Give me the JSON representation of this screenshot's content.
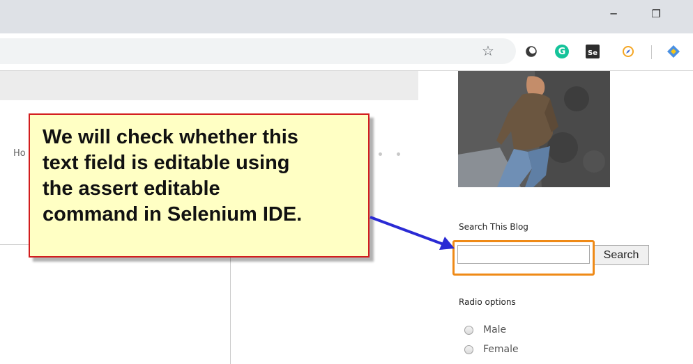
{
  "browser": {
    "window_controls": {
      "minimize_glyph": "─",
      "restore_glyph": "❐"
    },
    "toolbar": {
      "bookmark_icon": "☆",
      "extensions": [
        {
          "name": "circle-extension-icon",
          "color": "#444444"
        },
        {
          "name": "grammarly-icon",
          "letter": "G",
          "color": "#15c39a"
        },
        {
          "name": "selenium-ide-icon",
          "letter": "Se",
          "color": "#43b02a"
        },
        {
          "name": "compass-extension-icon",
          "color": "#f5a623"
        },
        {
          "name": "diamond-extension-icon",
          "color": "#4a90e2"
        }
      ]
    }
  },
  "page": {
    "nav_partial": "Ho",
    "sidebar": {
      "search_title": "Search This Blog",
      "search_input_value": "",
      "search_button": "Search",
      "radio_title": "Radio options",
      "radio_options": [
        "Male",
        "Female"
      ]
    }
  },
  "annotation": {
    "text": "We will check whether this text field is editable using the assert editable command in Selenium IDE.",
    "lines": [
      "We will check whether this",
      "text field is editable using",
      "the assert editable",
      "command in Selenium IDE."
    ],
    "colors": {
      "box_fill": "#ffffc4",
      "box_border": "#d21d1d",
      "arrow": "#2a2ad4",
      "highlight": "#ef8a17"
    }
  }
}
